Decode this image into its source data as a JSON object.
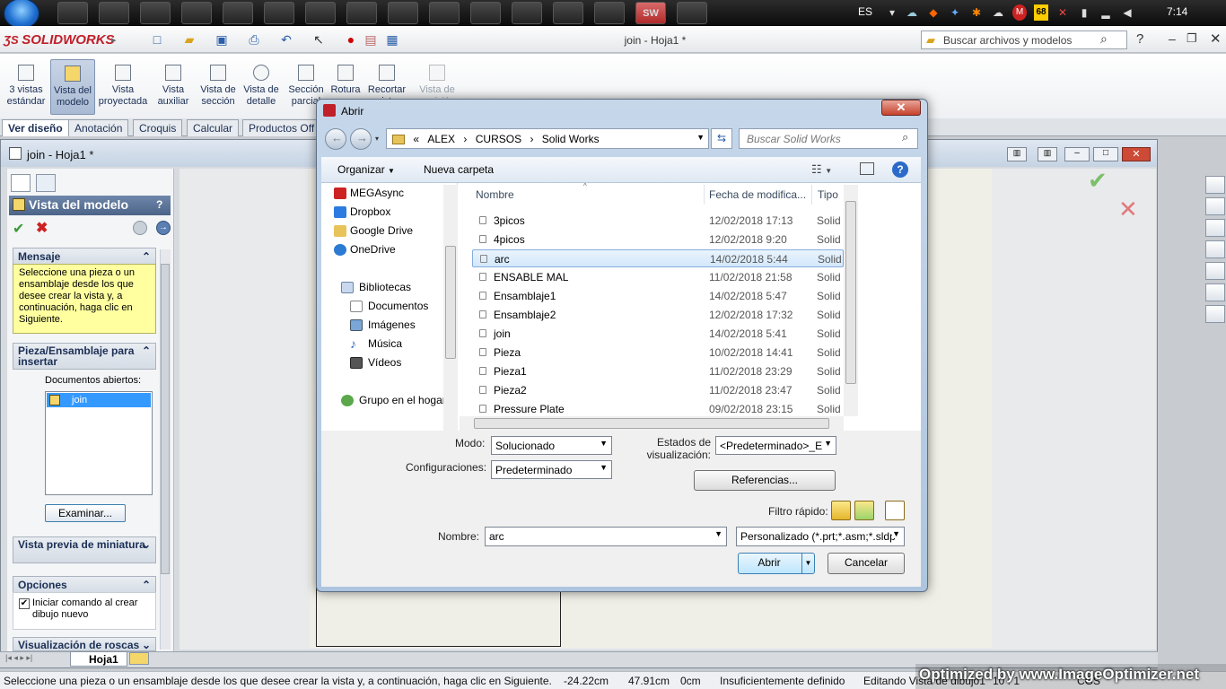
{
  "taskbar": {
    "app_buttons": [
      "",
      "",
      "ᴘᴄ",
      "",
      "N",
      "",
      "",
      "",
      "",
      "",
      "",
      "",
      "",
      "",
      "",
      ""
    ],
    "language": "ES",
    "clock": "7:14",
    "tray_badge": "68"
  },
  "solidworks": {
    "logo": "SOLIDWORKS",
    "doc_title": "join - Hoja1 *",
    "search_placeholder": "Buscar archivos y modelos"
  },
  "ribbon": {
    "buttons": [
      {
        "label": "3 vistas estándar"
      },
      {
        "label": "Vista del modelo"
      },
      {
        "label": "Vista proyectada"
      },
      {
        "label": "Vista auxiliar"
      },
      {
        "label": "Vista de sección"
      },
      {
        "label": "Vista de detalle"
      },
      {
        "label": "Sección parcial"
      },
      {
        "label": "Rotura"
      },
      {
        "label": "Recortar vista"
      },
      {
        "label": "Vista de posición"
      }
    ],
    "tabs": [
      "Ver diseño",
      "Anotación",
      "Croquis",
      "Calcular",
      "Productos Off"
    ]
  },
  "document_window": {
    "title": "join - Hoja1 *",
    "sheet_tab": "Hoja1"
  },
  "property_manager": {
    "title": "Vista del modelo",
    "message_header": "Mensaje",
    "message_text": "Seleccione una pieza o un ensamblaje desde los que desee crear la vista y, a continuación, haga clic en Siguiente.",
    "insert_header": "Pieza/Ensamblaje para insertar",
    "open_docs_label": "Documentos abiertos:",
    "open_docs": [
      "join"
    ],
    "browse_button": "Examinar...",
    "preview_header": "Vista previa de miniatura",
    "options_header": "Opciones",
    "option_checkbox": "Iniciar comando al crear dibujo nuevo",
    "threads_header": "Visualización de roscas"
  },
  "dialog": {
    "title": "Abrir",
    "breadcrumb": [
      "«",
      "ALEX",
      "CURSOS",
      "Solid Works"
    ],
    "search_placeholder": "Buscar Solid Works",
    "organize": "Organizar",
    "new_folder": "Nueva carpeta",
    "nav_items": [
      "MEGAsync",
      "Dropbox",
      "Google Drive",
      "OneDrive",
      "Bibliotecas",
      "Documentos",
      "Imágenes",
      "Música",
      "Vídeos",
      "Grupo en el hogar"
    ],
    "columns": {
      "name": "Nombre",
      "date": "Fecha de modifica...",
      "type": "Tipo"
    },
    "files": [
      {
        "name": "3picos",
        "date": "12/02/2018 17:13",
        "type": "Solid"
      },
      {
        "name": "4picos",
        "date": "12/02/2018 9:20",
        "type": "Solid"
      },
      {
        "name": "arc",
        "date": "14/02/2018 5:44",
        "type": "Solid",
        "selected": true
      },
      {
        "name": "ENSABLE MAL",
        "date": "11/02/2018 21:58",
        "type": "Solid"
      },
      {
        "name": "Ensamblaje1",
        "date": "14/02/2018 5:47",
        "type": "Solid"
      },
      {
        "name": "Ensamblaje2",
        "date": "12/02/2018 17:32",
        "type": "Solid"
      },
      {
        "name": "join",
        "date": "14/02/2018 5:41",
        "type": "Solid"
      },
      {
        "name": "Pieza",
        "date": "10/02/2018 14:41",
        "type": "Solid"
      },
      {
        "name": "Pieza1",
        "date": "11/02/2018 23:29",
        "type": "Solid"
      },
      {
        "name": "Pieza2",
        "date": "11/02/2018 23:47",
        "type": "Solid"
      },
      {
        "name": "Pressure Plate",
        "date": "09/02/2018 23:15",
        "type": "Solid"
      }
    ],
    "mode_label": "Modo:",
    "mode_value": "Solucionado",
    "config_label": "Configuraciones:",
    "config_value": "Predeterminado",
    "display_states_label": "Estados de visualización:",
    "display_states_value": "<Predeterminado>_E",
    "references_button": "Referencias...",
    "quick_filter_label": "Filtro rápido:",
    "filename_label": "Nombre:",
    "filename_value": "arc",
    "filetype_value": "Personalizado (*.prt;*.asm;*.sldp",
    "open_button": "Abrir",
    "cancel_button": "Cancelar"
  },
  "statusbar": {
    "message": "Seleccione una pieza o un ensamblaje desde los que desee crear la vista y, a continuación, haga clic en Siguiente.",
    "x": "-24.22cm",
    "y": "47.91cm",
    "z": "0cm",
    "definition": "Insuficientemente definido",
    "editing": "Editando Vista de dibujo1",
    "scale": "10 : 1",
    "units": "CGS",
    "watermark": "Optimized by www.ImageOptimizer.net"
  }
}
